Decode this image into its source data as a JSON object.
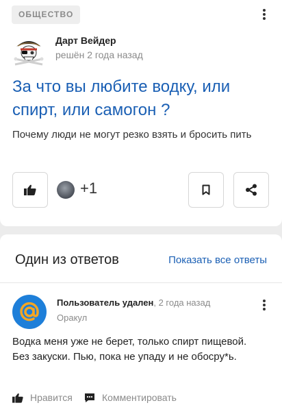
{
  "question": {
    "category": "ОБЩЕСТВО",
    "author": "Дарт Вейдер",
    "status": "решён 2 года назад",
    "title": "За что вы любите водку, или спирт, или самогон ?",
    "description": "Почему люди не могут резко взять и бросить пить",
    "likers_extra": "+1",
    "icons": {
      "like": "thumbs-up-icon",
      "bookmark": "bookmark-icon",
      "share": "share-icon",
      "more": "more-vertical-icon"
    }
  },
  "answers_section": {
    "title": "Один из ответов",
    "show_all": "Показать все ответы",
    "answer": {
      "author": "Пользователь удален",
      "time": ", 2 года назад",
      "role": "Оракул",
      "text": "Водка меня уже не берет, только спирт пищевой. Без закуски. Пью, пока не упаду и не обосру*ь.",
      "like_label": "Нравится",
      "comment_label": "Комментировать"
    }
  },
  "colors": {
    "link": "#1a5fb4",
    "mail_avatar": "#1e7fd9",
    "mail_at": "#f5a623",
    "muted": "#8a8a8a"
  }
}
